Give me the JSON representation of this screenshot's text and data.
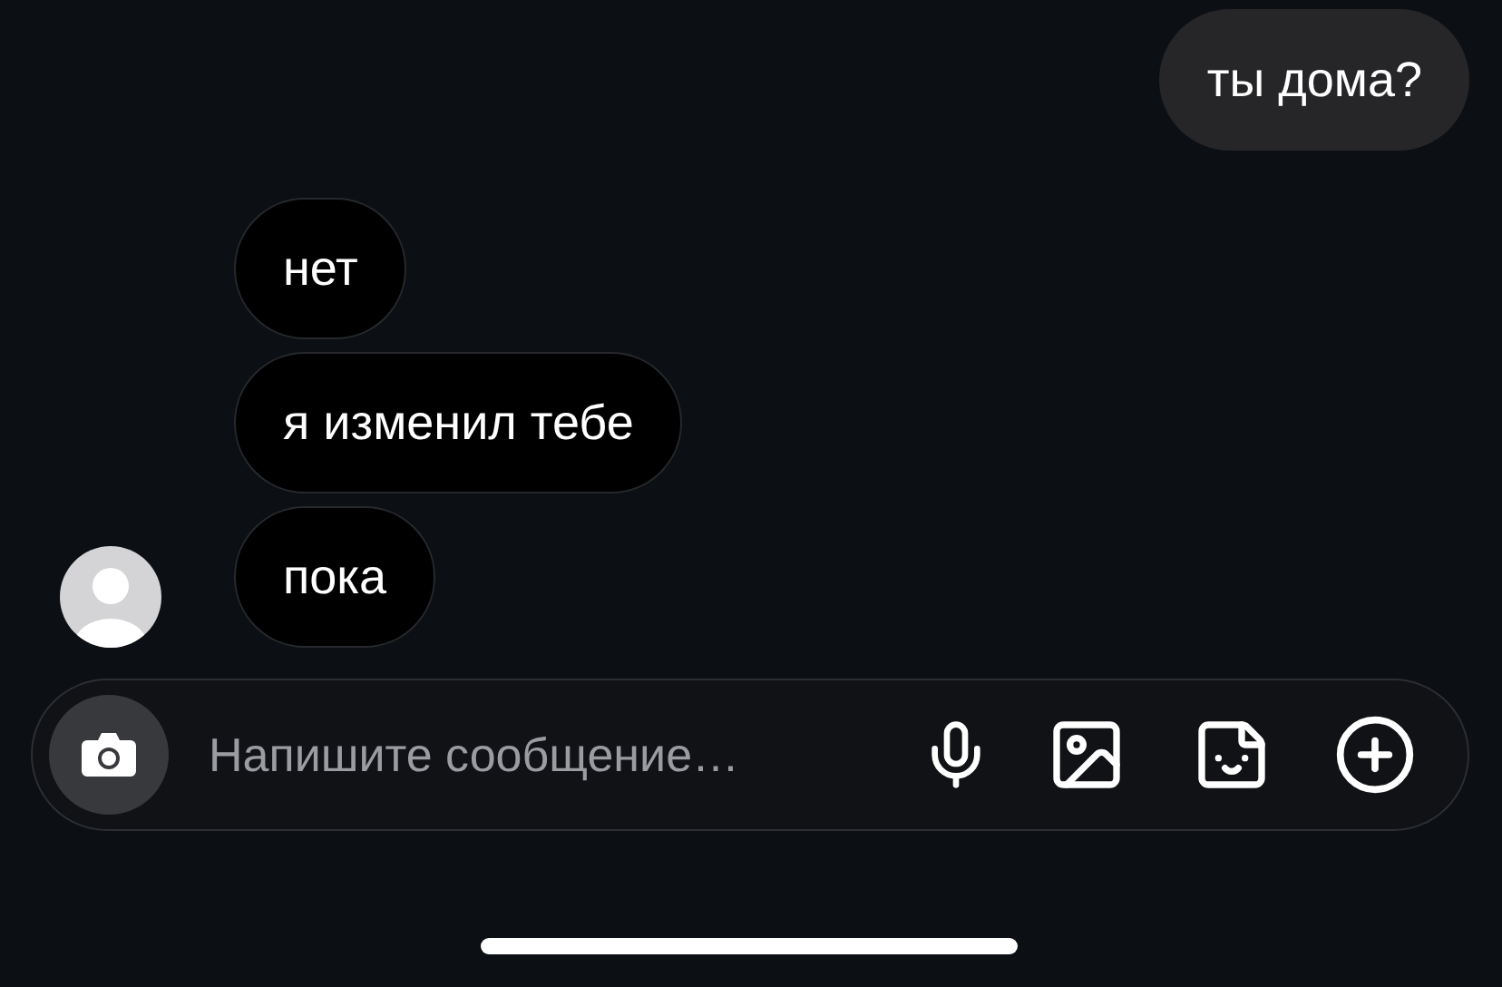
{
  "messages": [
    {
      "kind": "outgoing",
      "text": "ты дома?"
    },
    {
      "kind": "incoming",
      "text": "нет"
    },
    {
      "kind": "incoming",
      "text": "я изменил тебе"
    },
    {
      "kind": "incoming",
      "text": "пока"
    }
  ],
  "composer": {
    "placeholder": "Напишите сообщение…"
  }
}
